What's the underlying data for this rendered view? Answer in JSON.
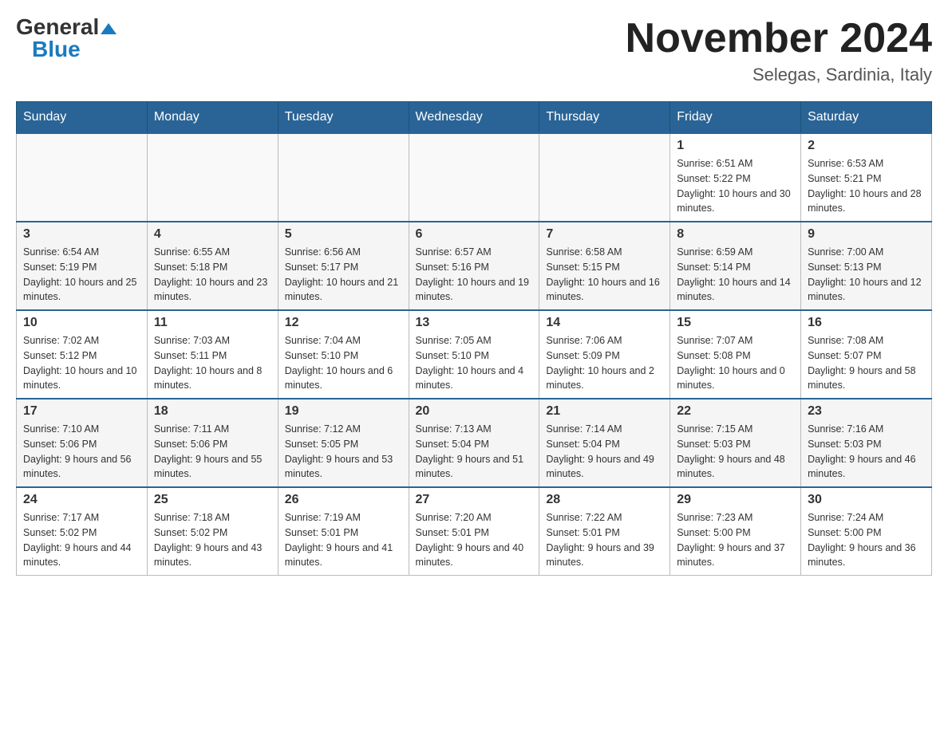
{
  "header": {
    "logo_general": "General",
    "logo_blue": "Blue",
    "month_title": "November 2024",
    "subtitle": "Selegas, Sardinia, Italy"
  },
  "weekdays": [
    "Sunday",
    "Monday",
    "Tuesday",
    "Wednesday",
    "Thursday",
    "Friday",
    "Saturday"
  ],
  "weeks": [
    [
      {
        "day": "",
        "sunrise": "",
        "sunset": "",
        "daylight": ""
      },
      {
        "day": "",
        "sunrise": "",
        "sunset": "",
        "daylight": ""
      },
      {
        "day": "",
        "sunrise": "",
        "sunset": "",
        "daylight": ""
      },
      {
        "day": "",
        "sunrise": "",
        "sunset": "",
        "daylight": ""
      },
      {
        "day": "",
        "sunrise": "",
        "sunset": "",
        "daylight": ""
      },
      {
        "day": "1",
        "sunrise": "Sunrise: 6:51 AM",
        "sunset": "Sunset: 5:22 PM",
        "daylight": "Daylight: 10 hours and 30 minutes."
      },
      {
        "day": "2",
        "sunrise": "Sunrise: 6:53 AM",
        "sunset": "Sunset: 5:21 PM",
        "daylight": "Daylight: 10 hours and 28 minutes."
      }
    ],
    [
      {
        "day": "3",
        "sunrise": "Sunrise: 6:54 AM",
        "sunset": "Sunset: 5:19 PM",
        "daylight": "Daylight: 10 hours and 25 minutes."
      },
      {
        "day": "4",
        "sunrise": "Sunrise: 6:55 AM",
        "sunset": "Sunset: 5:18 PM",
        "daylight": "Daylight: 10 hours and 23 minutes."
      },
      {
        "day": "5",
        "sunrise": "Sunrise: 6:56 AM",
        "sunset": "Sunset: 5:17 PM",
        "daylight": "Daylight: 10 hours and 21 minutes."
      },
      {
        "day": "6",
        "sunrise": "Sunrise: 6:57 AM",
        "sunset": "Sunset: 5:16 PM",
        "daylight": "Daylight: 10 hours and 19 minutes."
      },
      {
        "day": "7",
        "sunrise": "Sunrise: 6:58 AM",
        "sunset": "Sunset: 5:15 PM",
        "daylight": "Daylight: 10 hours and 16 minutes."
      },
      {
        "day": "8",
        "sunrise": "Sunrise: 6:59 AM",
        "sunset": "Sunset: 5:14 PM",
        "daylight": "Daylight: 10 hours and 14 minutes."
      },
      {
        "day": "9",
        "sunrise": "Sunrise: 7:00 AM",
        "sunset": "Sunset: 5:13 PM",
        "daylight": "Daylight: 10 hours and 12 minutes."
      }
    ],
    [
      {
        "day": "10",
        "sunrise": "Sunrise: 7:02 AM",
        "sunset": "Sunset: 5:12 PM",
        "daylight": "Daylight: 10 hours and 10 minutes."
      },
      {
        "day": "11",
        "sunrise": "Sunrise: 7:03 AM",
        "sunset": "Sunset: 5:11 PM",
        "daylight": "Daylight: 10 hours and 8 minutes."
      },
      {
        "day": "12",
        "sunrise": "Sunrise: 7:04 AM",
        "sunset": "Sunset: 5:10 PM",
        "daylight": "Daylight: 10 hours and 6 minutes."
      },
      {
        "day": "13",
        "sunrise": "Sunrise: 7:05 AM",
        "sunset": "Sunset: 5:10 PM",
        "daylight": "Daylight: 10 hours and 4 minutes."
      },
      {
        "day": "14",
        "sunrise": "Sunrise: 7:06 AM",
        "sunset": "Sunset: 5:09 PM",
        "daylight": "Daylight: 10 hours and 2 minutes."
      },
      {
        "day": "15",
        "sunrise": "Sunrise: 7:07 AM",
        "sunset": "Sunset: 5:08 PM",
        "daylight": "Daylight: 10 hours and 0 minutes."
      },
      {
        "day": "16",
        "sunrise": "Sunrise: 7:08 AM",
        "sunset": "Sunset: 5:07 PM",
        "daylight": "Daylight: 9 hours and 58 minutes."
      }
    ],
    [
      {
        "day": "17",
        "sunrise": "Sunrise: 7:10 AM",
        "sunset": "Sunset: 5:06 PM",
        "daylight": "Daylight: 9 hours and 56 minutes."
      },
      {
        "day": "18",
        "sunrise": "Sunrise: 7:11 AM",
        "sunset": "Sunset: 5:06 PM",
        "daylight": "Daylight: 9 hours and 55 minutes."
      },
      {
        "day": "19",
        "sunrise": "Sunrise: 7:12 AM",
        "sunset": "Sunset: 5:05 PM",
        "daylight": "Daylight: 9 hours and 53 minutes."
      },
      {
        "day": "20",
        "sunrise": "Sunrise: 7:13 AM",
        "sunset": "Sunset: 5:04 PM",
        "daylight": "Daylight: 9 hours and 51 minutes."
      },
      {
        "day": "21",
        "sunrise": "Sunrise: 7:14 AM",
        "sunset": "Sunset: 5:04 PM",
        "daylight": "Daylight: 9 hours and 49 minutes."
      },
      {
        "day": "22",
        "sunrise": "Sunrise: 7:15 AM",
        "sunset": "Sunset: 5:03 PM",
        "daylight": "Daylight: 9 hours and 48 minutes."
      },
      {
        "day": "23",
        "sunrise": "Sunrise: 7:16 AM",
        "sunset": "Sunset: 5:03 PM",
        "daylight": "Daylight: 9 hours and 46 minutes."
      }
    ],
    [
      {
        "day": "24",
        "sunrise": "Sunrise: 7:17 AM",
        "sunset": "Sunset: 5:02 PM",
        "daylight": "Daylight: 9 hours and 44 minutes."
      },
      {
        "day": "25",
        "sunrise": "Sunrise: 7:18 AM",
        "sunset": "Sunset: 5:02 PM",
        "daylight": "Daylight: 9 hours and 43 minutes."
      },
      {
        "day": "26",
        "sunrise": "Sunrise: 7:19 AM",
        "sunset": "Sunset: 5:01 PM",
        "daylight": "Daylight: 9 hours and 41 minutes."
      },
      {
        "day": "27",
        "sunrise": "Sunrise: 7:20 AM",
        "sunset": "Sunset: 5:01 PM",
        "daylight": "Daylight: 9 hours and 40 minutes."
      },
      {
        "day": "28",
        "sunrise": "Sunrise: 7:22 AM",
        "sunset": "Sunset: 5:01 PM",
        "daylight": "Daylight: 9 hours and 39 minutes."
      },
      {
        "day": "29",
        "sunrise": "Sunrise: 7:23 AM",
        "sunset": "Sunset: 5:00 PM",
        "daylight": "Daylight: 9 hours and 37 minutes."
      },
      {
        "day": "30",
        "sunrise": "Sunrise: 7:24 AM",
        "sunset": "Sunset: 5:00 PM",
        "daylight": "Daylight: 9 hours and 36 minutes."
      }
    ]
  ]
}
